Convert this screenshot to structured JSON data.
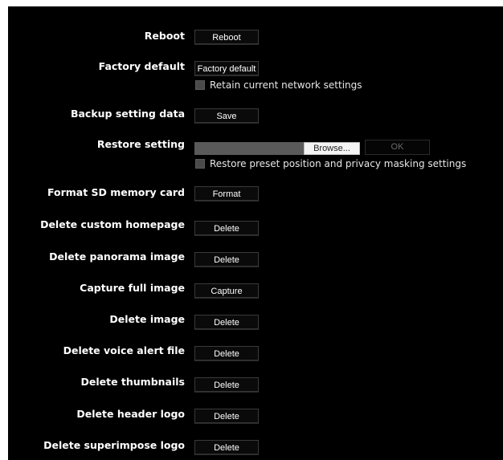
{
  "settings": {
    "reboot": {
      "label": "Reboot",
      "button": "Reboot"
    },
    "factory_default": {
      "label": "Factory default",
      "button": "Factory default",
      "checkbox_label": "Retain current network settings",
      "checkbox_checked": false
    },
    "backup": {
      "label": "Backup setting data",
      "button": "Save"
    },
    "restore": {
      "label": "Restore setting",
      "file_value": "",
      "browse_button": "Browse...",
      "ok_button": "OK",
      "ok_enabled": false,
      "checkbox_label": "Restore preset position and privacy masking settings",
      "checkbox_checked": false
    },
    "format_sd": {
      "label": "Format SD memory card",
      "button": "Format"
    },
    "delete_custom_homepage": {
      "label": "Delete custom homepage",
      "button": "Delete"
    },
    "delete_panorama": {
      "label": "Delete panorama image",
      "button": "Delete"
    },
    "capture_full": {
      "label": "Capture full image",
      "button": "Capture"
    },
    "delete_image": {
      "label": "Delete image",
      "button": "Delete"
    },
    "delete_voice_alert": {
      "label": "Delete voice alert file",
      "button": "Delete"
    },
    "delete_thumbnails": {
      "label": "Delete thumbnails",
      "button": "Delete"
    },
    "delete_header_logo": {
      "label": "Delete header logo",
      "button": "Delete"
    },
    "delete_superimpose_logo": {
      "label": "Delete superimpose logo",
      "button": "Delete"
    }
  },
  "colors": {
    "background": "#000000",
    "text": "#ffffff",
    "checkbox": "#4a4a4a",
    "browse_button": "#f3f3f3"
  }
}
